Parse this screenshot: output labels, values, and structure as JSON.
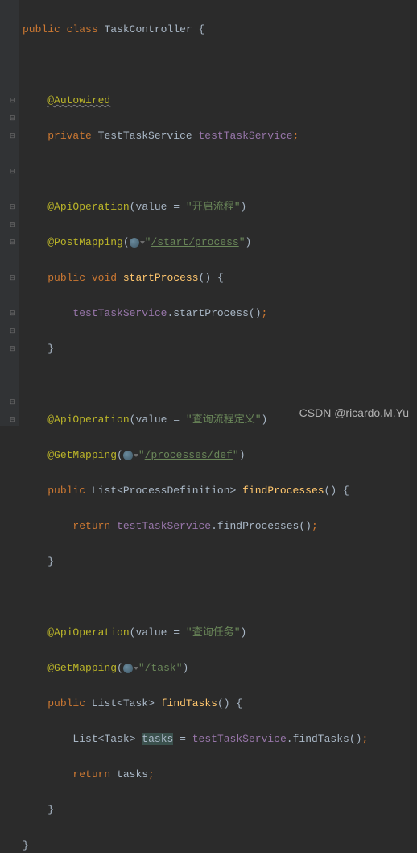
{
  "code": {
    "kw_public": "public",
    "kw_class": "class",
    "kw_private": "private",
    "kw_void": "void",
    "kw_return": "return",
    "class_name": "TaskController",
    "brace_open": "{",
    "brace_close": "}",
    "paren_open": "(",
    "paren_close": ")",
    "semi": ";",
    "eq": "=",
    "dot": ".",
    "comma": ",",
    "lt": "<",
    "gt": ">",
    "autowired": "@Autowired",
    "field_type": "TestTaskService",
    "field_name": "testTaskService",
    "api_op": "@ApiOperation",
    "api_value": "value",
    "str_start": "\"开启流程\"",
    "post_mapping": "@PostMapping",
    "url_start": "/start/process",
    "method_startProcess": "startProcess",
    "str_processes": "\"查询流程定义\"",
    "get_mapping": "@GetMapping",
    "url_processes": "/processes/def",
    "type_list": "List",
    "type_pd": "ProcessDefinition",
    "method_findProcesses": "findProcesses",
    "str_tasks": "\"查询任务\"",
    "url_task": "/task",
    "type_task": "Task",
    "method_findTasks": "findTasks",
    "var_tasks": "tasks"
  },
  "watermark": "CSDN @ricardo.M.Yu"
}
